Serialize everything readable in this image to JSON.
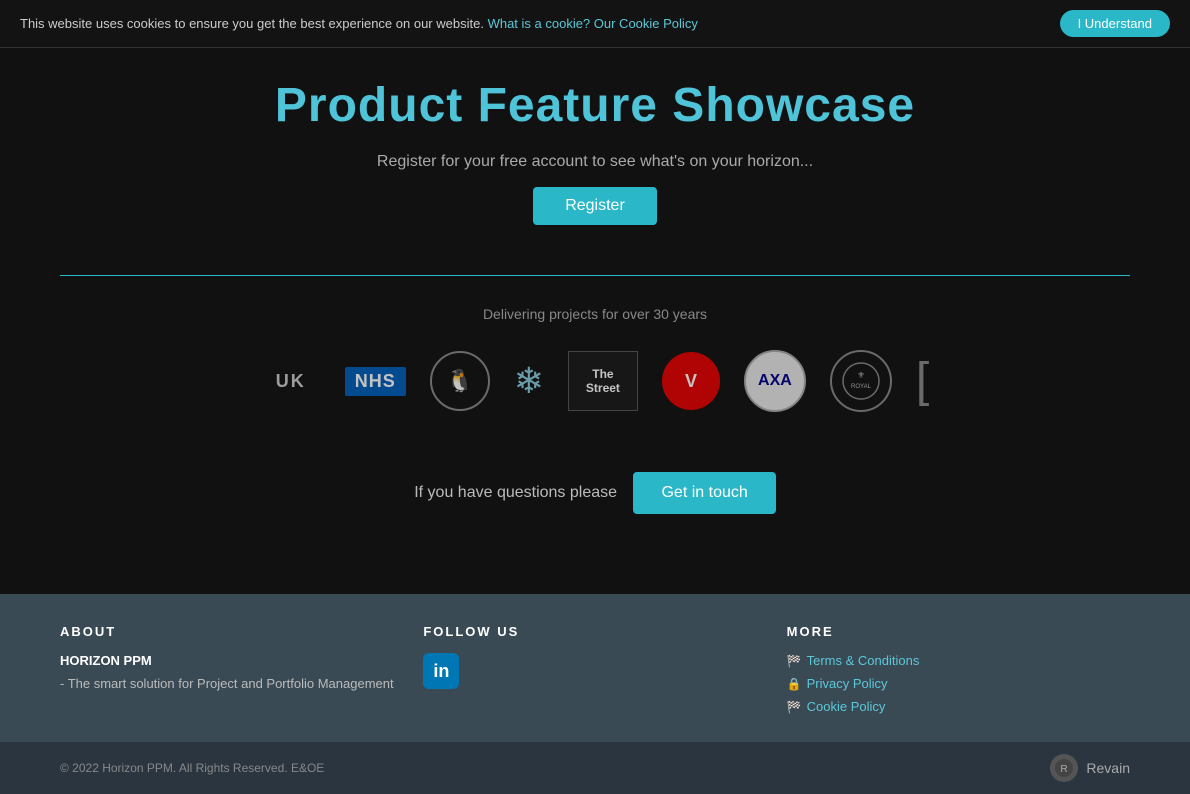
{
  "cookie": {
    "message": "This website uses cookies to ensure you get the best experience on our website.",
    "link_text": "What is a cookie? Our Cookie Policy",
    "button_label": "I Understand"
  },
  "header": {
    "title": "Product Feature Showcase"
  },
  "main": {
    "register_text": "Register for your free account to see what's on your horizon...",
    "register_button": "Register",
    "divider": true,
    "delivering_text": "Delivering projects for over 30 years",
    "logos": [
      {
        "id": "uk",
        "type": "uk",
        "alt": "UK"
      },
      {
        "id": "nhs",
        "type": "nhs",
        "alt": "NHS"
      },
      {
        "id": "penguin",
        "type": "penguin",
        "alt": "Penguin"
      },
      {
        "id": "snowflake",
        "type": "snowflake",
        "alt": "Snowflake"
      },
      {
        "id": "thestreet",
        "type": "thestreet",
        "alt": "TheStreet"
      },
      {
        "id": "vodafone",
        "type": "vodafone",
        "alt": "Vodafone"
      },
      {
        "id": "axa",
        "type": "axa",
        "alt": "AXA"
      },
      {
        "id": "royal",
        "type": "royal",
        "alt": "Royal Exchange"
      },
      {
        "id": "bracket",
        "type": "bracket",
        "alt": "Bracket Corp"
      }
    ]
  },
  "contact": {
    "text": "If you have questions please",
    "button_label": "Get in touch"
  },
  "footer": {
    "about": {
      "heading": "ABOUT",
      "company_name": "HORIZON PPM",
      "description": "- The smart solution for Project and Portfolio Management"
    },
    "follow": {
      "heading": "FOLLOW US",
      "linkedin_url": "#"
    },
    "more": {
      "heading": "MORE",
      "links": [
        {
          "icon": "🏁",
          "label": "Terms & Conditions",
          "href": "#"
        },
        {
          "icon": "🔒",
          "label": "Privacy Policy",
          "href": "#"
        },
        {
          "icon": "🏁",
          "label": "Cookie Policy",
          "href": "#"
        }
      ]
    }
  },
  "bottom_bar": {
    "copyright": "© 2022 Horizon PPM. All Rights Reserved. E&OE",
    "revain_label": "Revain"
  }
}
